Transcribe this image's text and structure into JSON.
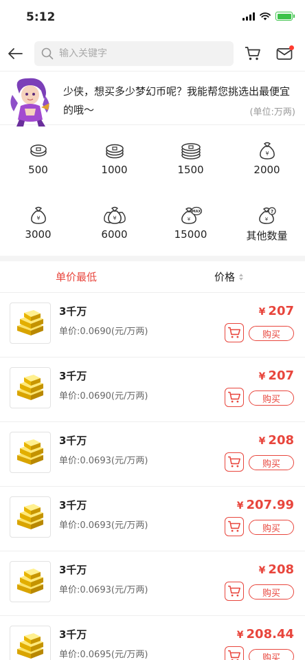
{
  "status": {
    "time": "5:12"
  },
  "search": {
    "placeholder": "输入关键字"
  },
  "banner": {
    "message": "少侠，想买多少梦幻币呢？我能帮您挑选出最便宜的哦～",
    "unit": "(单位:万两)"
  },
  "quick": [
    {
      "label": "500",
      "icon": "coin-stack-1-icon"
    },
    {
      "label": "1000",
      "icon": "coin-stack-2-icon"
    },
    {
      "label": "1500",
      "icon": "coin-stack-3-icon"
    },
    {
      "label": "2000",
      "icon": "money-bag-icon"
    },
    {
      "label": "3000",
      "icon": "money-bag-icon"
    },
    {
      "label": "6000",
      "icon": "money-bags-icon"
    },
    {
      "label": "15000",
      "icon": "money-bag-max-icon"
    },
    {
      "label": "其他数量",
      "icon": "money-bag-question-icon"
    }
  ],
  "sort": {
    "unit_price": "单价最低",
    "price": "价格"
  },
  "listing": {
    "currency": "¥",
    "buy_label": "购买",
    "items": [
      {
        "title": "3千万",
        "unit_price": "单价:0.0690(元/万两)",
        "price": "207"
      },
      {
        "title": "3千万",
        "unit_price": "单价:0.0690(元/万两)",
        "price": "207"
      },
      {
        "title": "3千万",
        "unit_price": "单价:0.0693(元/万两)",
        "price": "208"
      },
      {
        "title": "3千万",
        "unit_price": "单价:0.0693(元/万两)",
        "price": "207.99"
      },
      {
        "title": "3千万",
        "unit_price": "单价:0.0693(元/万两)",
        "price": "208"
      },
      {
        "title": "3千万",
        "unit_price": "单价:0.0695(元/万两)",
        "price": "208.44"
      }
    ]
  },
  "colors": {
    "accent": "#e8453c",
    "gold": "#f2c200",
    "battery": "#3cc24a"
  }
}
